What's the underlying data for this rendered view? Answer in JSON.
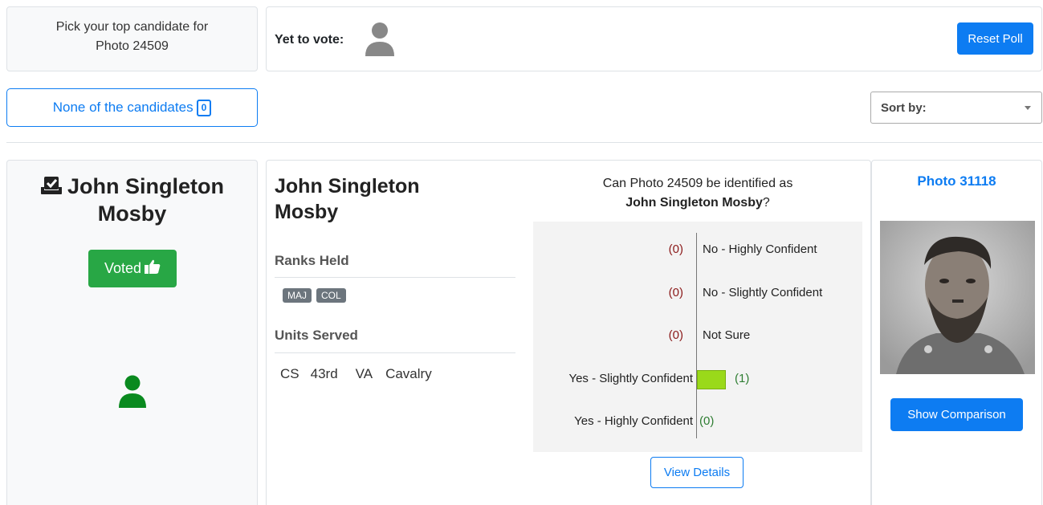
{
  "prompt_box": {
    "line1": "Pick your top candidate for",
    "line2": "Photo 24509"
  },
  "voting": {
    "yet_to_vote_label": "Yet to vote:",
    "reset_label": "Reset Poll"
  },
  "none_button": {
    "label": "None of the candidates",
    "count": "0"
  },
  "sort": {
    "label": "Sort by:"
  },
  "candidate_card": {
    "name_line1": "John Singleton",
    "name_line2": "Mosby",
    "voted_label": "Voted"
  },
  "details": {
    "name_line1": "John Singleton",
    "name_line2": "Mosby",
    "ranks_title": "Ranks Held",
    "ranks": [
      "MAJ",
      "COL"
    ],
    "units_title": "Units Served",
    "units": [
      "CS",
      "43rd",
      "VA",
      "Cavalry"
    ]
  },
  "poll": {
    "question_line1": "Can Photo 24509 be identified as",
    "question_name": "John Singleton Mosby",
    "question_end": "?",
    "rows": [
      {
        "label": "No - Highly Confident",
        "count": "(0)",
        "value": 0
      },
      {
        "label": "No - Slightly Confident",
        "count": "(0)",
        "value": 0
      },
      {
        "label": "Not Sure",
        "count": "(0)",
        "value": 0
      },
      {
        "label": "Yes - Slightly Confident",
        "count": "(1)",
        "value": 1
      },
      {
        "label": "Yes - Highly Confident",
        "count": "(0)",
        "value": 0
      }
    ],
    "view_details_label": "View Details",
    "colors": {
      "no": "#8b1a1a",
      "unsure": "#d4a017",
      "yes": "#2e7d32",
      "bar": "#9ad91a"
    }
  },
  "photo_card": {
    "title": "Photo 31118",
    "show_comparison_label": "Show Comparison"
  }
}
